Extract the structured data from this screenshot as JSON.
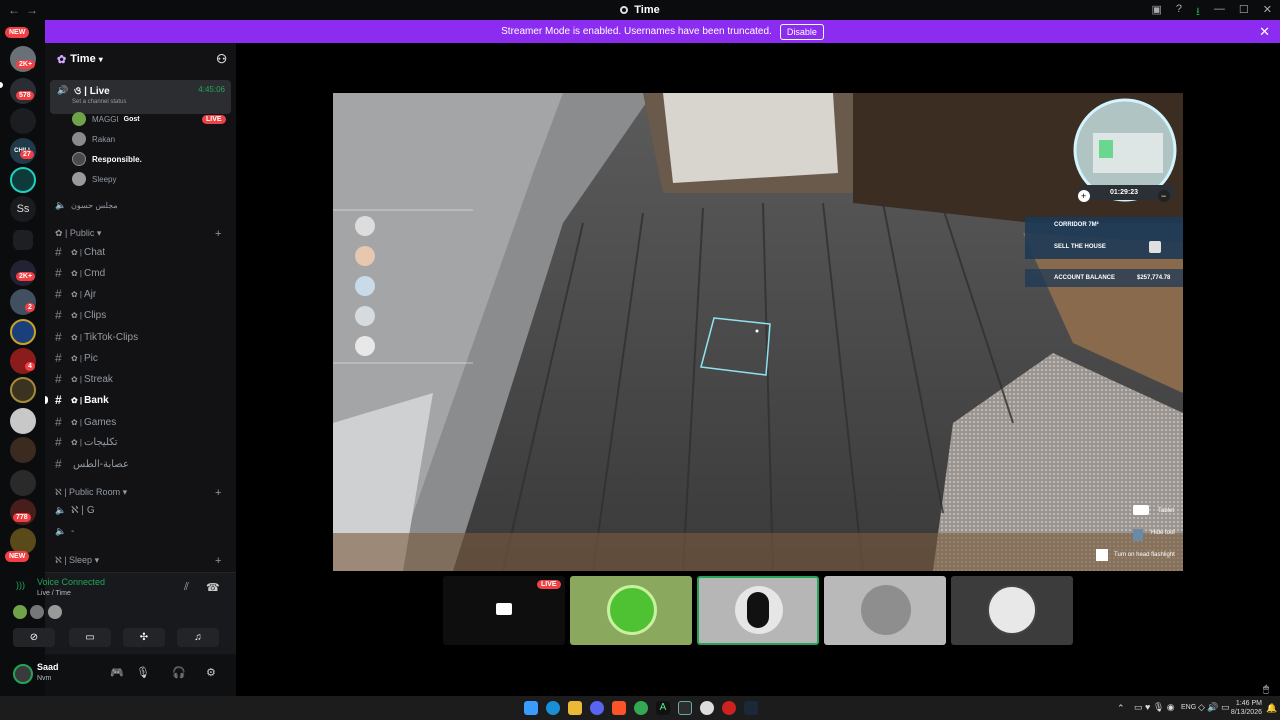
{
  "window": {
    "title": "Time"
  },
  "banner": {
    "text": "Streamer Mode is enabled. Usernames have been truncated.",
    "button": "Disable"
  },
  "guilds": {
    "badges": [
      "NEW",
      "2K+",
      "578",
      "27",
      "2K+",
      "2",
      "4",
      "778",
      "NEW"
    ],
    "text_icon": "Ss",
    "chill_label": "CHILL"
  },
  "server": {
    "name": "Time"
  },
  "active_voice": {
    "prefix": "ও",
    "name": "Live",
    "status": "Set a channel status",
    "timer": "4:45:06",
    "members": [
      {
        "name": "MAGGI",
        "tag": "Gost",
        "live": "LIVE",
        "color": "#6fa34a"
      },
      {
        "name": "Rakan",
        "color": "#8a8a8a"
      },
      {
        "name": "Responsible.",
        "color": "#4a4a4a",
        "bold": true
      },
      {
        "name": "Sleepy",
        "color": "#9a9a9a"
      }
    ]
  },
  "voice_channel_2": "مجلس حسون",
  "categories": {
    "public": "Public",
    "public_room": "Public Room",
    "sleep": "Sleep"
  },
  "channels": [
    {
      "name": "Chat",
      "active": false
    },
    {
      "name": "Cmd",
      "active": false
    },
    {
      "name": "Ajr",
      "active": false
    },
    {
      "name": "Clips",
      "active": false
    },
    {
      "name": "TikTok-Clips",
      "active": false
    },
    {
      "name": "Pic",
      "active": false
    },
    {
      "name": "Streak",
      "active": false
    },
    {
      "name": "Bank",
      "active": true
    },
    {
      "name": "Games",
      "active": false
    },
    {
      "name": "تكليجات",
      "active": false
    },
    {
      "name": "عصابة-الطس",
      "active": false
    }
  ],
  "public_room_channels": [
    "G",
    "-"
  ],
  "voice_status": {
    "connected": "Voice Connected",
    "channel": "Live / Time"
  },
  "user": {
    "name": "Saad",
    "status": "Nvm"
  },
  "hud": {
    "map_timer": "01:29:23",
    "corridor": "CORRIDOR 7M²",
    "sell": "SELL THE HOUSE",
    "balance_label": "ACCOUNT BALANCE",
    "balance_value": "$257,774.78",
    "hints": [
      "Tablet",
      "Hide tool",
      "Turn on head flashlight"
    ]
  },
  "tiles": {
    "live_label": "LIVE"
  },
  "taskbar": {
    "lang": "ENG",
    "time": "1:46 PM",
    "date": "8/13/2026"
  },
  "colors": {
    "accent": "#8c2cf0",
    "green": "#23a559",
    "red": "#ed4245"
  }
}
